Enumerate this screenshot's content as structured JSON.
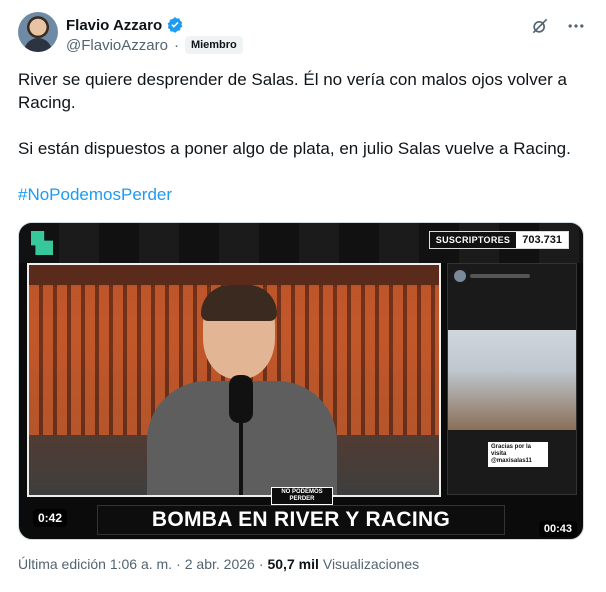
{
  "author": {
    "name": "Flavio Azzaro",
    "handle": "@FlavioAzzaro",
    "separator": "·",
    "badge": "Miembro",
    "verified_color": "#1d9bf0"
  },
  "actions": {
    "grok_icon": "grok-slash-icon",
    "more_icon": "more-dots-icon"
  },
  "tweet": {
    "paragraph1": "River se quiere desprender de Salas. Él no vería con malos ojos volver a Racing.",
    "paragraph2": "Si están dispuestos a poner algo de plata, en julio Salas vuelve a Racing.",
    "hashtag": "#NoPodemosPerder",
    "hashtag_color": "#1d9bf0"
  },
  "media": {
    "subs_label": "SUSCRIPTORES",
    "subs_count": "703.731",
    "banner": "BOMBA EN RIVER Y RACING",
    "logo_text": "NO PODEMOS PERDER",
    "story_caption": "Gracias por la visita @maxisalas11",
    "time_left": "0:42",
    "time_right": "00:43"
  },
  "meta": {
    "edited": "Última edición 1:06 a. m.",
    "dot1": "·",
    "date": "2 abr. 2026",
    "dot2": "·",
    "views_count": "50,7 mil",
    "views_label": "Visualizaciones"
  }
}
